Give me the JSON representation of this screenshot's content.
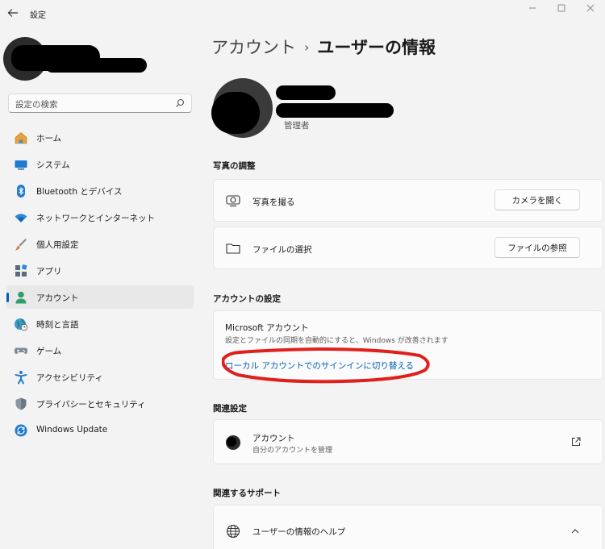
{
  "window": {
    "title": "設定"
  },
  "sidebar": {
    "search_placeholder": "設定の検索",
    "items": [
      {
        "label": "ホーム",
        "icon": "home-icon"
      },
      {
        "label": "システム",
        "icon": "system-icon"
      },
      {
        "label": "Bluetooth とデバイス",
        "icon": "bluetooth-icon"
      },
      {
        "label": "ネットワークとインターネット",
        "icon": "wifi-icon"
      },
      {
        "label": "個人用設定",
        "icon": "brush-icon"
      },
      {
        "label": "アプリ",
        "icon": "apps-icon"
      },
      {
        "label": "アカウント",
        "icon": "account-icon",
        "active": true
      },
      {
        "label": "時刻と言語",
        "icon": "globe-clock-icon"
      },
      {
        "label": "ゲーム",
        "icon": "gamepad-icon"
      },
      {
        "label": "アクセシビリティ",
        "icon": "accessibility-icon"
      },
      {
        "label": "プライバシーとセキュリティ",
        "icon": "shield-icon"
      },
      {
        "label": "Windows Update",
        "icon": "update-icon"
      }
    ]
  },
  "main": {
    "breadcrumb": {
      "parent": "アカウント",
      "separator": "›",
      "current": "ユーザーの情報"
    },
    "profile": {
      "role": "管理者"
    },
    "photo_section": {
      "title": "写真の調整",
      "take_photo": {
        "label": "写真を撮る",
        "button": "カメラを開く"
      },
      "choose_file": {
        "label": "ファイルの選択",
        "button": "ファイルの参照"
      }
    },
    "account_section": {
      "title": "アカウントの設定",
      "ms_title": "Microsoft アカウント",
      "ms_desc": "設定とファイルの同期を自動的にすると、Windows が改善されます",
      "link": "ローカル アカウントでのサインインに切り替える"
    },
    "related_section": {
      "title": "関連設定",
      "item_title": "アカウント",
      "item_desc": "自分のアカウントを管理"
    },
    "support_section": {
      "title": "関連するサポート",
      "item_title": "ユーザーの情報のヘルプ"
    }
  },
  "colors": {
    "accent": "#005fb8",
    "annotation": "#e0201c"
  }
}
